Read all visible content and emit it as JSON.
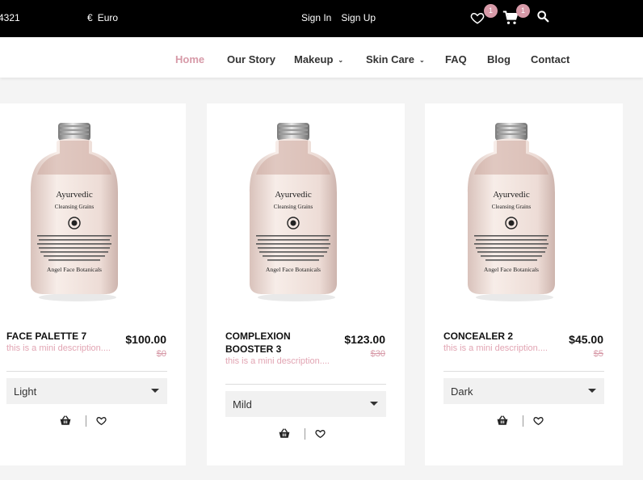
{
  "topbar": {
    "phone": "4321",
    "currency_symbol": "€",
    "currency": "Euro",
    "sign_in": "Sign In",
    "sign_up": "Sign Up",
    "wishlist_count": "1",
    "cart_count": "1"
  },
  "nav": {
    "home": "Home",
    "our_story": "Our Story",
    "makeup": "Makeup",
    "skin_care": "Skin Care",
    "faq": "FAQ",
    "blog": "Blog",
    "contact": "Contact"
  },
  "colors": {
    "accent": "#d79aa8",
    "topbar": "#000000"
  },
  "label": {
    "brand": "Ayurvedic",
    "sub": "Cleansing Grains",
    "company": "Angel Face Botanicals"
  },
  "products": [
    {
      "name_line1": "FACE PALETTE 7",
      "name_line2": "",
      "description": "this is a mini description....",
      "price": "$100.00",
      "old_price": "$0",
      "variant": "Light"
    },
    {
      "name_line1": "COMPLEXION",
      "name_line2": "BOOSTER 3",
      "description": "this is a mini description....",
      "price": "$123.00",
      "old_price": "$30",
      "variant": "Mild"
    },
    {
      "name_line1": "CONCEALER 2",
      "name_line2": "",
      "description": "this is a mini description....",
      "price": "$45.00",
      "old_price": "$5",
      "variant": "Dark"
    }
  ]
}
